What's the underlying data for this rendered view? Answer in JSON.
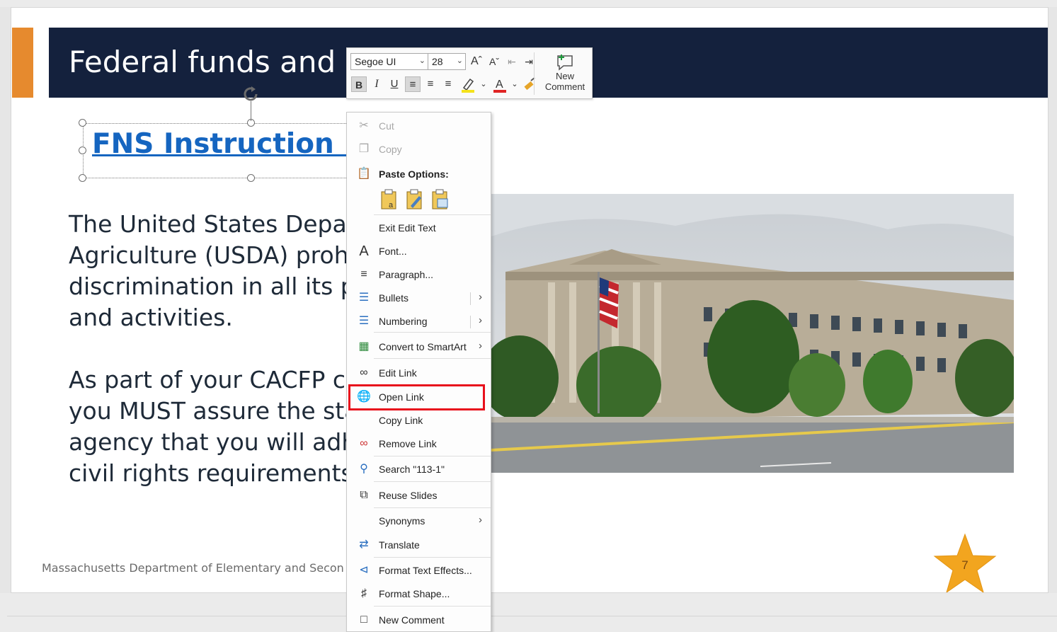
{
  "slide": {
    "title": "Federal funds and c",
    "link_text": "FNS Instruction 11",
    "paragraph1": [
      "The United States Depar",
      "Agriculture (USDA) prohi",
      "discrimination in all its p",
      "and activities."
    ],
    "paragraph2": [
      "As part of your CACFP co",
      "you MUST assure the sta",
      "agency that you will adh",
      "civil rights requirements."
    ],
    "footer": "Massachusetts Department of Elementary and Secon",
    "page_number": "7"
  },
  "mini_toolbar": {
    "font_name": "Segoe UI",
    "font_size": "28",
    "bold": "B",
    "italic": "I",
    "underline": "U",
    "grow_font": "Aˆ",
    "shrink_font": "Aˇ",
    "new_comment_line1": "New",
    "new_comment_line2": "Comment"
  },
  "context_menu": {
    "cut": "Cut",
    "copy": "Copy",
    "paste_options": "Paste Options:",
    "exit_edit_text": "Exit Edit Text",
    "font": "Font...",
    "paragraph": "Paragraph...",
    "bullets": "Bullets",
    "numbering": "Numbering",
    "convert_smartart": "Convert to SmartArt",
    "edit_link": "Edit Link",
    "open_link": "Open Link",
    "copy_link": "Copy Link",
    "remove_link": "Remove Link",
    "search": "Search \"113-1\"",
    "reuse_slides": "Reuse Slides",
    "synonyms": "Synonyms",
    "translate": "Translate",
    "format_text_effects": "Format Text Effects...",
    "format_shape": "Format Shape...",
    "new_comment": "New Comment"
  },
  "colors": {
    "title_band": "#14213d",
    "accent_orange": "#e68a2e",
    "link_blue": "#1565c0",
    "highlight_red": "#e8101c",
    "star": "#f2a51f"
  },
  "icons": {
    "rotate": "rotate-handle-icon",
    "cut": "scissors-icon",
    "copy": "copy-icon",
    "paste": "clipboard-icon",
    "font": "font-icon",
    "paragraph": "paragraph-icon",
    "bullets": "bullets-icon",
    "numbering": "numbering-icon",
    "smartart": "smartart-icon",
    "edit_link": "link-icon",
    "open_link": "globe-link-icon",
    "remove_link": "unlink-icon",
    "search": "search-icon",
    "reuse": "reuse-slides-icon",
    "translate": "translate-icon",
    "text_effects": "text-effects-icon",
    "format_shape": "paint-bucket-icon",
    "comment": "comment-icon"
  }
}
